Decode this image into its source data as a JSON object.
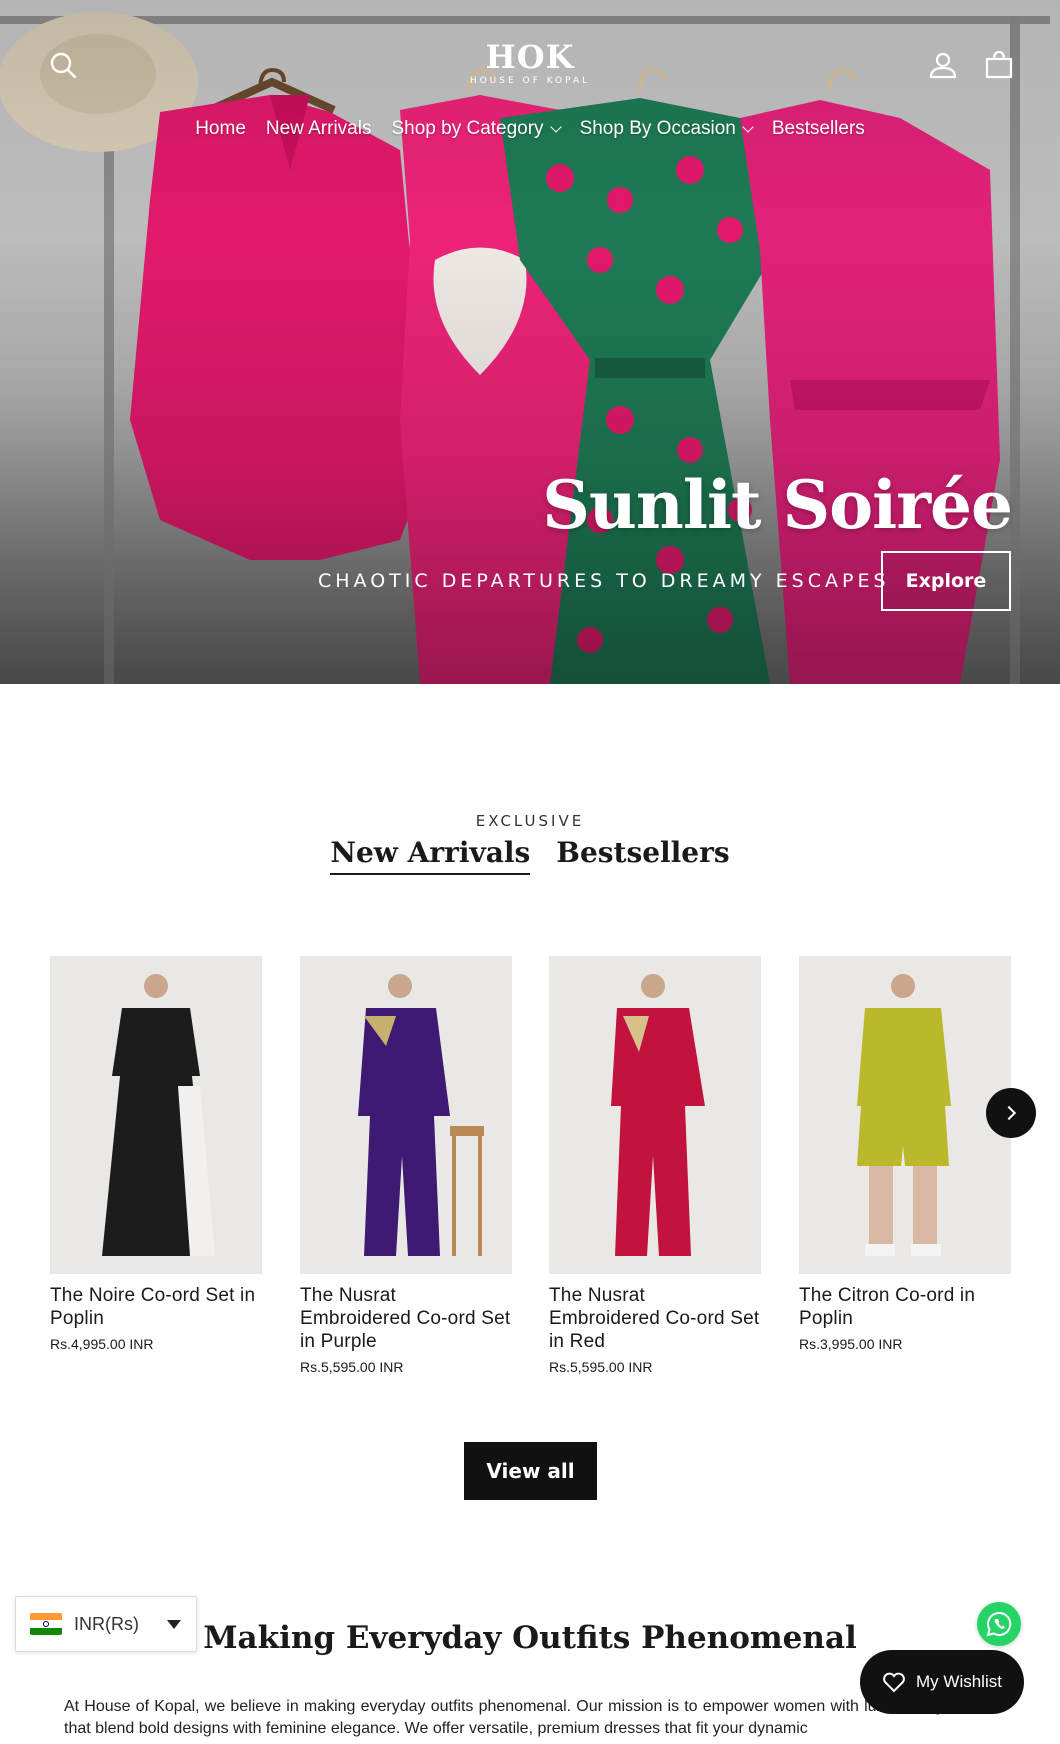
{
  "header": {
    "logo_mark": "HOK",
    "logo_sub": "HOUSE OF KOPAL",
    "nav": [
      {
        "label": "Home"
      },
      {
        "label": "New Arrivals"
      },
      {
        "label": "Shop by Category"
      },
      {
        "label": "Shop By Occasion"
      },
      {
        "label": "Bestsellers"
      }
    ]
  },
  "hero": {
    "title": "Sunlit Soirée",
    "subtitle": "CHAOTIC DEPARTURES TO DREAMY ESCAPES",
    "button": "Explore"
  },
  "collection": {
    "eyebrow": "EXCLUSIVE",
    "tabs": [
      {
        "label": "New Arrivals",
        "active": true
      },
      {
        "label": "Bestsellers",
        "active": false
      }
    ],
    "products": [
      {
        "title": "The Noire Co-ord Set in Poplin",
        "price": "Rs.4,995.00 INR",
        "color": "#1c1c1c"
      },
      {
        "title": "The Nusrat Embroidered Co-ord Set in Purple",
        "price": "Rs.5,595.00 INR",
        "color": "#3f1a73"
      },
      {
        "title": "The Nusrat Embroidered Co-ord Set in Red",
        "price": "Rs.5,595.00 INR",
        "color": "#c2133f"
      },
      {
        "title": "The Citron Co-ord in Poplin",
        "price": "Rs.3,995.00 INR",
        "color": "#bcb82c"
      }
    ],
    "view_all": "View all"
  },
  "about": {
    "title": "Making Everyday Outfits Phenomenal",
    "text": "At House of Kopal, we believe in making everyday outfits phenomenal. Our mission is to empower women with luxurious garments that blend bold designs with feminine elegance. We offer versatile, premium dresses that fit your dynamic"
  },
  "widgets": {
    "currency": "INR(Rs)",
    "wishlist": "My Wishlist"
  },
  "colors": {
    "pink": "#e8206e",
    "green": "#1f7a55",
    "dark": "#111111"
  }
}
